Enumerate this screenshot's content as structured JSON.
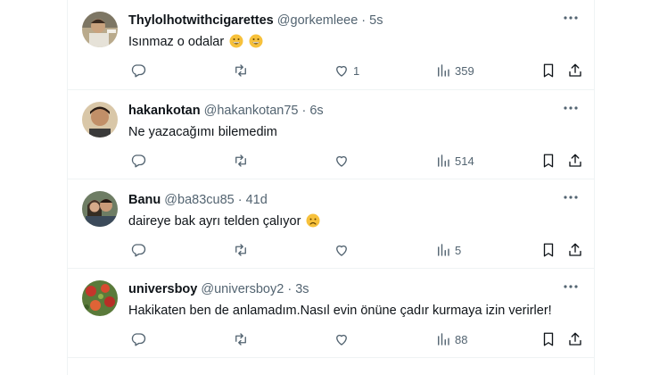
{
  "tweets": [
    {
      "name": "Thylolhotwithcigarettes",
      "handle": "@gorkemleee",
      "separator": "·",
      "time": "5s",
      "text": "Isınmaz o odalar",
      "emoji": [
        "grinning-face",
        "grinning-face"
      ],
      "likes": "1",
      "views": "359",
      "avatar": "avatar-person-1"
    },
    {
      "name": "hakankotan",
      "handle": "@hakankotan75",
      "separator": "·",
      "time": "6s",
      "text": "Ne yazacağımı bilemedim",
      "emoji": [],
      "likes": "",
      "views": "514",
      "avatar": "avatar-person-2"
    },
    {
      "name": "Banu",
      "handle": "@ba83cu85",
      "separator": "·",
      "time": "41d",
      "text": "daireye bak ayrı telden çalıyor",
      "emoji": [
        "frowning-face"
      ],
      "likes": "",
      "views": "5",
      "avatar": "avatar-couple"
    },
    {
      "name": "universboy",
      "handle": "@universboy2",
      "separator": "·",
      "time": "3s",
      "text": "Hakikaten ben de anlamadım.Nasıl evin önüne çadır kurmaya izin verirler!",
      "emoji": [],
      "likes": "",
      "views": "88",
      "avatar": "avatar-flowers"
    }
  ],
  "colors": {
    "text": "#0f1419",
    "secondary": "#536471",
    "border": "#eff3f4",
    "emoji": "#f7c13b"
  },
  "icons": [
    "reply-icon",
    "retweet-icon",
    "like-icon",
    "views-icon",
    "bookmark-icon",
    "share-icon",
    "more-icon"
  ]
}
